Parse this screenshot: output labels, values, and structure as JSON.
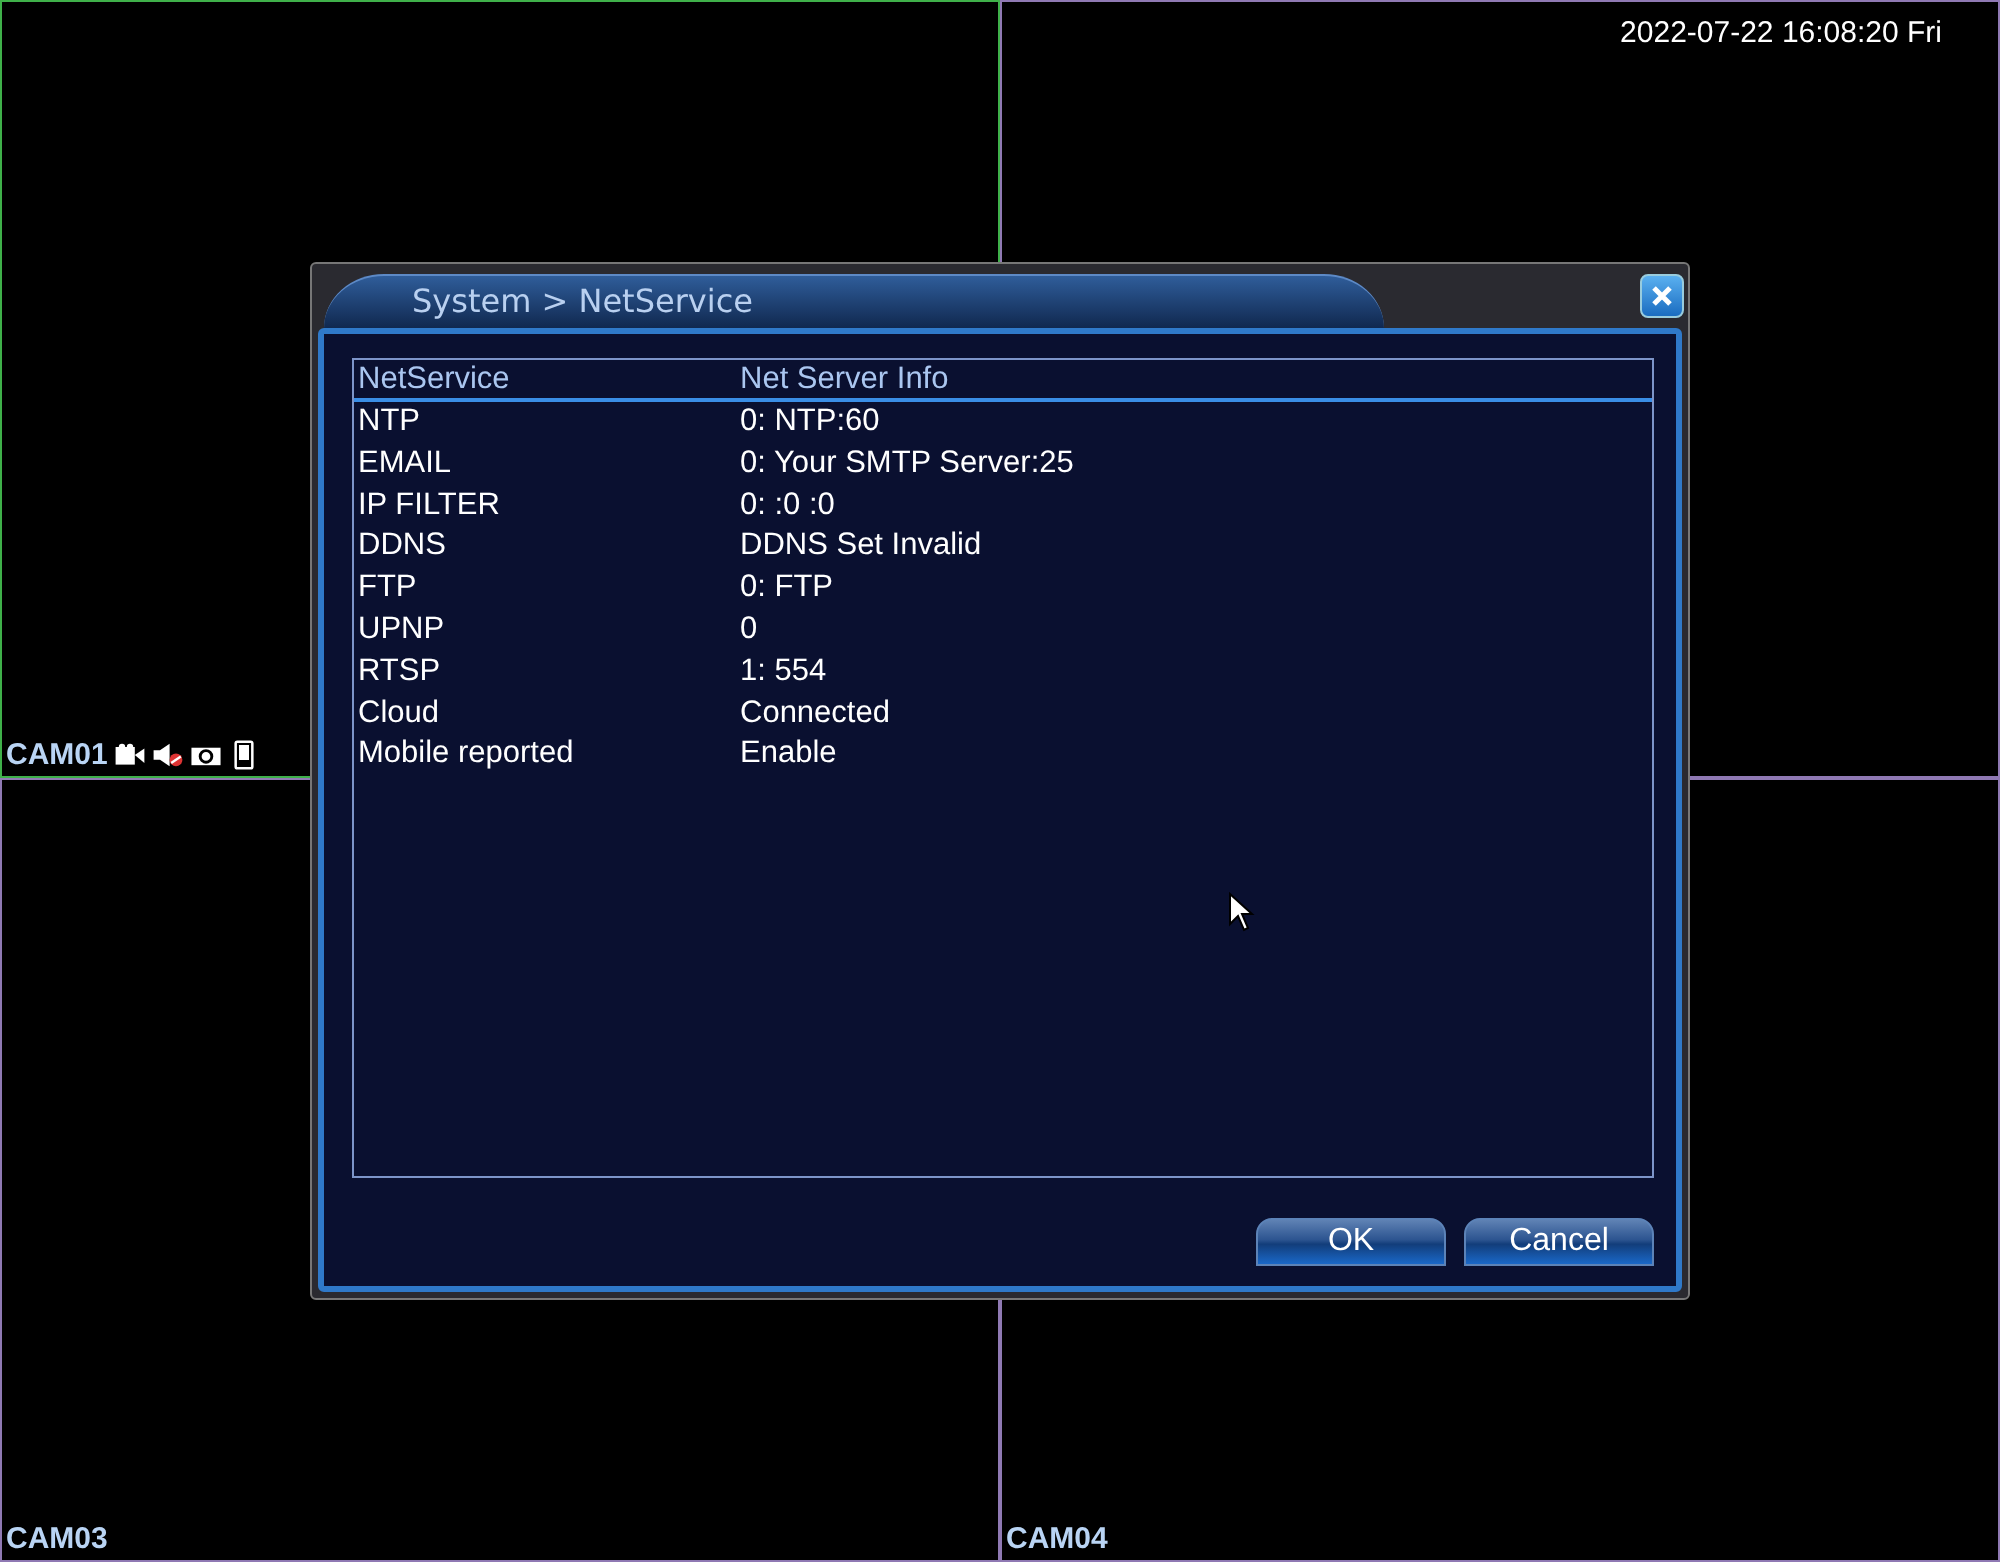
{
  "clock": "2022-07-22 16:08:20 Fri",
  "tiles": [
    {
      "label": "CAM01",
      "selected": true,
      "recording": true,
      "muted": true
    },
    {
      "selected": false
    },
    {
      "label": "CAM03",
      "selected": false
    },
    {
      "label": "CAM04",
      "selected": false
    }
  ],
  "dialog": {
    "title": "System > NetService",
    "columns": [
      "NetService",
      "Net Server Info"
    ],
    "rows": [
      {
        "service": "NTP",
        "info": "0: NTP:60"
      },
      {
        "service": "EMAIL",
        "info": "0: Your SMTP Server:25"
      },
      {
        "service": "IP FILTER",
        "info": "0: :0 :0"
      },
      {
        "service": "DDNS",
        "info": "DDNS Set Invalid"
      },
      {
        "service": "FTP",
        "info": "0: FTP"
      },
      {
        "service": "UPNP",
        "info": "0"
      },
      {
        "service": "RTSP",
        "info": "1: 554"
      },
      {
        "service": "Cloud",
        "info": "Connected"
      },
      {
        "service": "Mobile reported",
        "info": "Enable"
      }
    ],
    "buttons": [
      "OK",
      "Cancel"
    ]
  }
}
